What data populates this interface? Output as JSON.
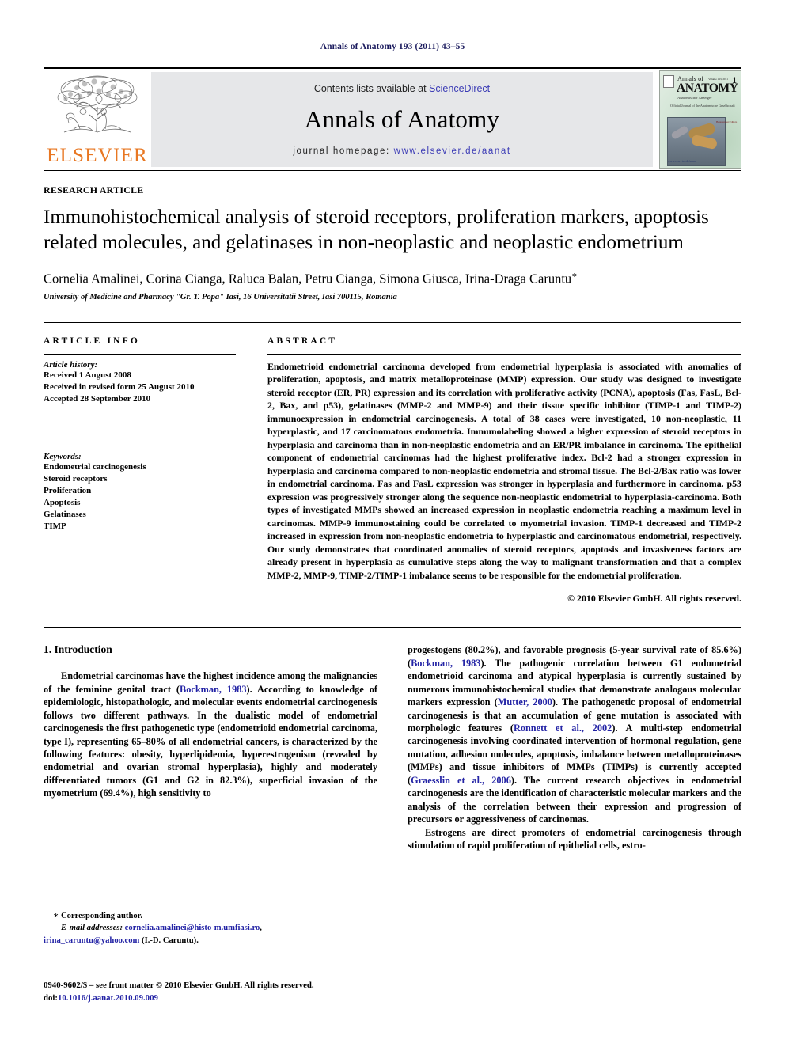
{
  "running_head": "Annals of Anatomy 193 (2011) 43–55",
  "masthead": {
    "publisher_name": "ELSEVIER",
    "contents_prefix": "Contents lists available at ",
    "contents_link": "ScienceDirect",
    "journal_title": "Annals of Anatomy",
    "homepage_prefix": "journal homepage: ",
    "homepage_url": "www.elsevier.de/aanat",
    "cover": {
      "line1": "Annals of",
      "line2": "ANATOMY",
      "line3": "Anatomischer Anzeiger",
      "line4": "Official Journal of the Anatomische Gesellschaft",
      "issue_number": "1",
      "volume_line": "Volume 193, 2011",
      "imprint": "ELSEVIER",
      "side_text": "Herausgeber/Editors",
      "caption": "www.elsevier.de/aanat"
    }
  },
  "article": {
    "type": "RESEARCH ARTICLE",
    "title": "Immunohistochemical analysis of steroid receptors, proliferation markers, apoptosis related molecules, and gelatinases in non-neoplastic and neoplastic endometrium",
    "authors": "Cornelia Amalinei, Corina Cianga, Raluca Balan, Petru Cianga, Simona Giusca, Irina-Draga Caruntu",
    "corresponding_marker": "∗",
    "affiliation": "University of Medicine and Pharmacy \"Gr. T. Popa\" Iasi, 16 Universitatii Street, Iasi 700115, Romania"
  },
  "info": {
    "heading": "ARTICLE INFO",
    "history_label": "Article history:",
    "history": [
      "Received 1 August 2008",
      "Received in revised form 25 August 2010",
      "Accepted 28 September 2010"
    ],
    "keywords_label": "Keywords:",
    "keywords": [
      "Endometrial carcinogenesis",
      "Steroid receptors",
      "Proliferation",
      "Apoptosis",
      "Gelatinases",
      "TIMP"
    ]
  },
  "abstract": {
    "heading": "ABSTRACT",
    "text": "Endometrioid endometrial carcinoma developed from endometrial hyperplasia is associated with anomalies of proliferation, apoptosis, and matrix metalloproteinase (MMP) expression. Our study was designed to investigate steroid receptor (ER, PR) expression and its correlation with proliferative activity (PCNA), apoptosis (Fas, FasL, Bcl-2, Bax, and p53), gelatinases (MMP-2 and MMP-9) and their tissue specific inhibitor (TIMP-1 and TIMP-2) immunoexpression in endometrial carcinogenesis. A total of 38 cases were investigated, 10 non-neoplastic, 11 hyperplastic, and 17 carcinomatous endometria. Immunolabeling showed a higher expression of steroid receptors in hyperplasia and carcinoma than in non-neoplastic endometria and an ER/PR imbalance in carcinoma. The epithelial component of endometrial carcinomas had the highest proliferative index. Bcl-2 had a stronger expression in hyperplasia and carcinoma compared to non-neoplastic endometria and stromal tissue. The Bcl-2/Bax ratio was lower in endometrial carcinoma. Fas and FasL expression was stronger in hyperplasia and furthermore in carcinoma. p53 expression was progressively stronger along the sequence non-neoplastic endometrial to hyperplasia-carcinoma. Both types of investigated MMPs showed an increased expression in neoplastic endometria reaching a maximum level in carcinomas. MMP-9 immunostaining could be correlated to myometrial invasion. TIMP-1 decreased and TIMP-2 increased in expression from non-neoplastic endometria to hyperplastic and carcinomatous endometrial, respectively. Our study demonstrates that coordinated anomalies of steroid receptors, apoptosis and invasiveness factors are already present in hyperplasia as cumulative steps along the way to malignant transformation and that a complex MMP-2, MMP-9, TIMP-2/TIMP-1 imbalance seems to be responsible for the endometrial proliferation.",
    "copyright": "© 2010 Elsevier GmbH. All rights reserved."
  },
  "body": {
    "section_number_title": "1. Introduction",
    "left_paragraph_1_a": "Endometrial carcinomas have the highest incidence among the malignancies of the feminine genital tract (",
    "left_ref_1": "Bockman, 1983",
    "left_paragraph_1_b": "). According to knowledge of epidemiologic, histopathologic, and molecular events endometrial carcinogenesis follows two different pathways. In the dualistic model of endometrial carcinogenesis the first pathogenetic type (endometrioid endometrial carcinoma, type I), representing 65–80% of all endometrial cancers, is characterized by the following features: obesity, hyperlipidemia, hyperestrogenism (revealed by endometrial and ovarian stromal hyperplasia), highly and moderately differentiated tumors (G1 and G2 in 82.3%), superficial invasion of the myometrium (69.4%), high sensitivity to",
    "right_paragraph_1_a": "progestogens (80.2%), and favorable prognosis (5-year survival rate of 85.6%) (",
    "right_ref_1": "Bockman, 1983",
    "right_paragraph_1_b": "). The pathogenic correlation between G1 endometrial endometrioid carcinoma and atypical hyperplasia is currently sustained by numerous immunohistochemical studies that demonstrate analogous molecular markers expression (",
    "right_ref_2": "Mutter, 2000",
    "right_paragraph_1_c": "). The pathogenetic proposal of endometrial carcinogenesis is that an accumulation of gene mutation is associated with morphologic features (",
    "right_ref_3": "Ronnett et al., 2002",
    "right_paragraph_1_d": "). A multi-step endometrial carcinogenesis involving coordinated intervention of hormonal regulation, gene mutation, adhesion molecules, apoptosis, imbalance between metalloproteinases (MMPs) and tissue inhibitors of MMPs (TIMPs) is currently accepted (",
    "right_ref_4": "Graesslin et al., 2006",
    "right_paragraph_1_e": "). The current research objectives in endometrial carcinogenesis are the identification of characteristic molecular markers and the analysis of the correlation between their expression and progression of precursors or aggressiveness of carcinomas.",
    "right_paragraph_2": "Estrogens are direct promoters of endometrial carcinogenesis through stimulation of rapid proliferation of epithelial cells, estro-"
  },
  "footnotes": {
    "corresponding_marker": "∗",
    "corresponding_label": "Corresponding author.",
    "email_label": "E-mail addresses:",
    "email_1": "cornelia.amalinei@histo-m.umfiasi.ro",
    "email_separator": ",",
    "email_2": "irina_caruntu@yahoo.com",
    "email_2_attrib": "(I.-D. Caruntu).",
    "issn_line": "0940-9602/$ – see front matter © 2010 Elsevier GmbH. All rights reserved.",
    "doi_label": "doi:",
    "doi_value": "10.1016/j.aanat.2010.09.009"
  },
  "colors": {
    "link": "#2323a5",
    "elsevier_orange": "#E87722",
    "running_head": "#1b1b5e",
    "band_gray": "#e6e7e9"
  }
}
